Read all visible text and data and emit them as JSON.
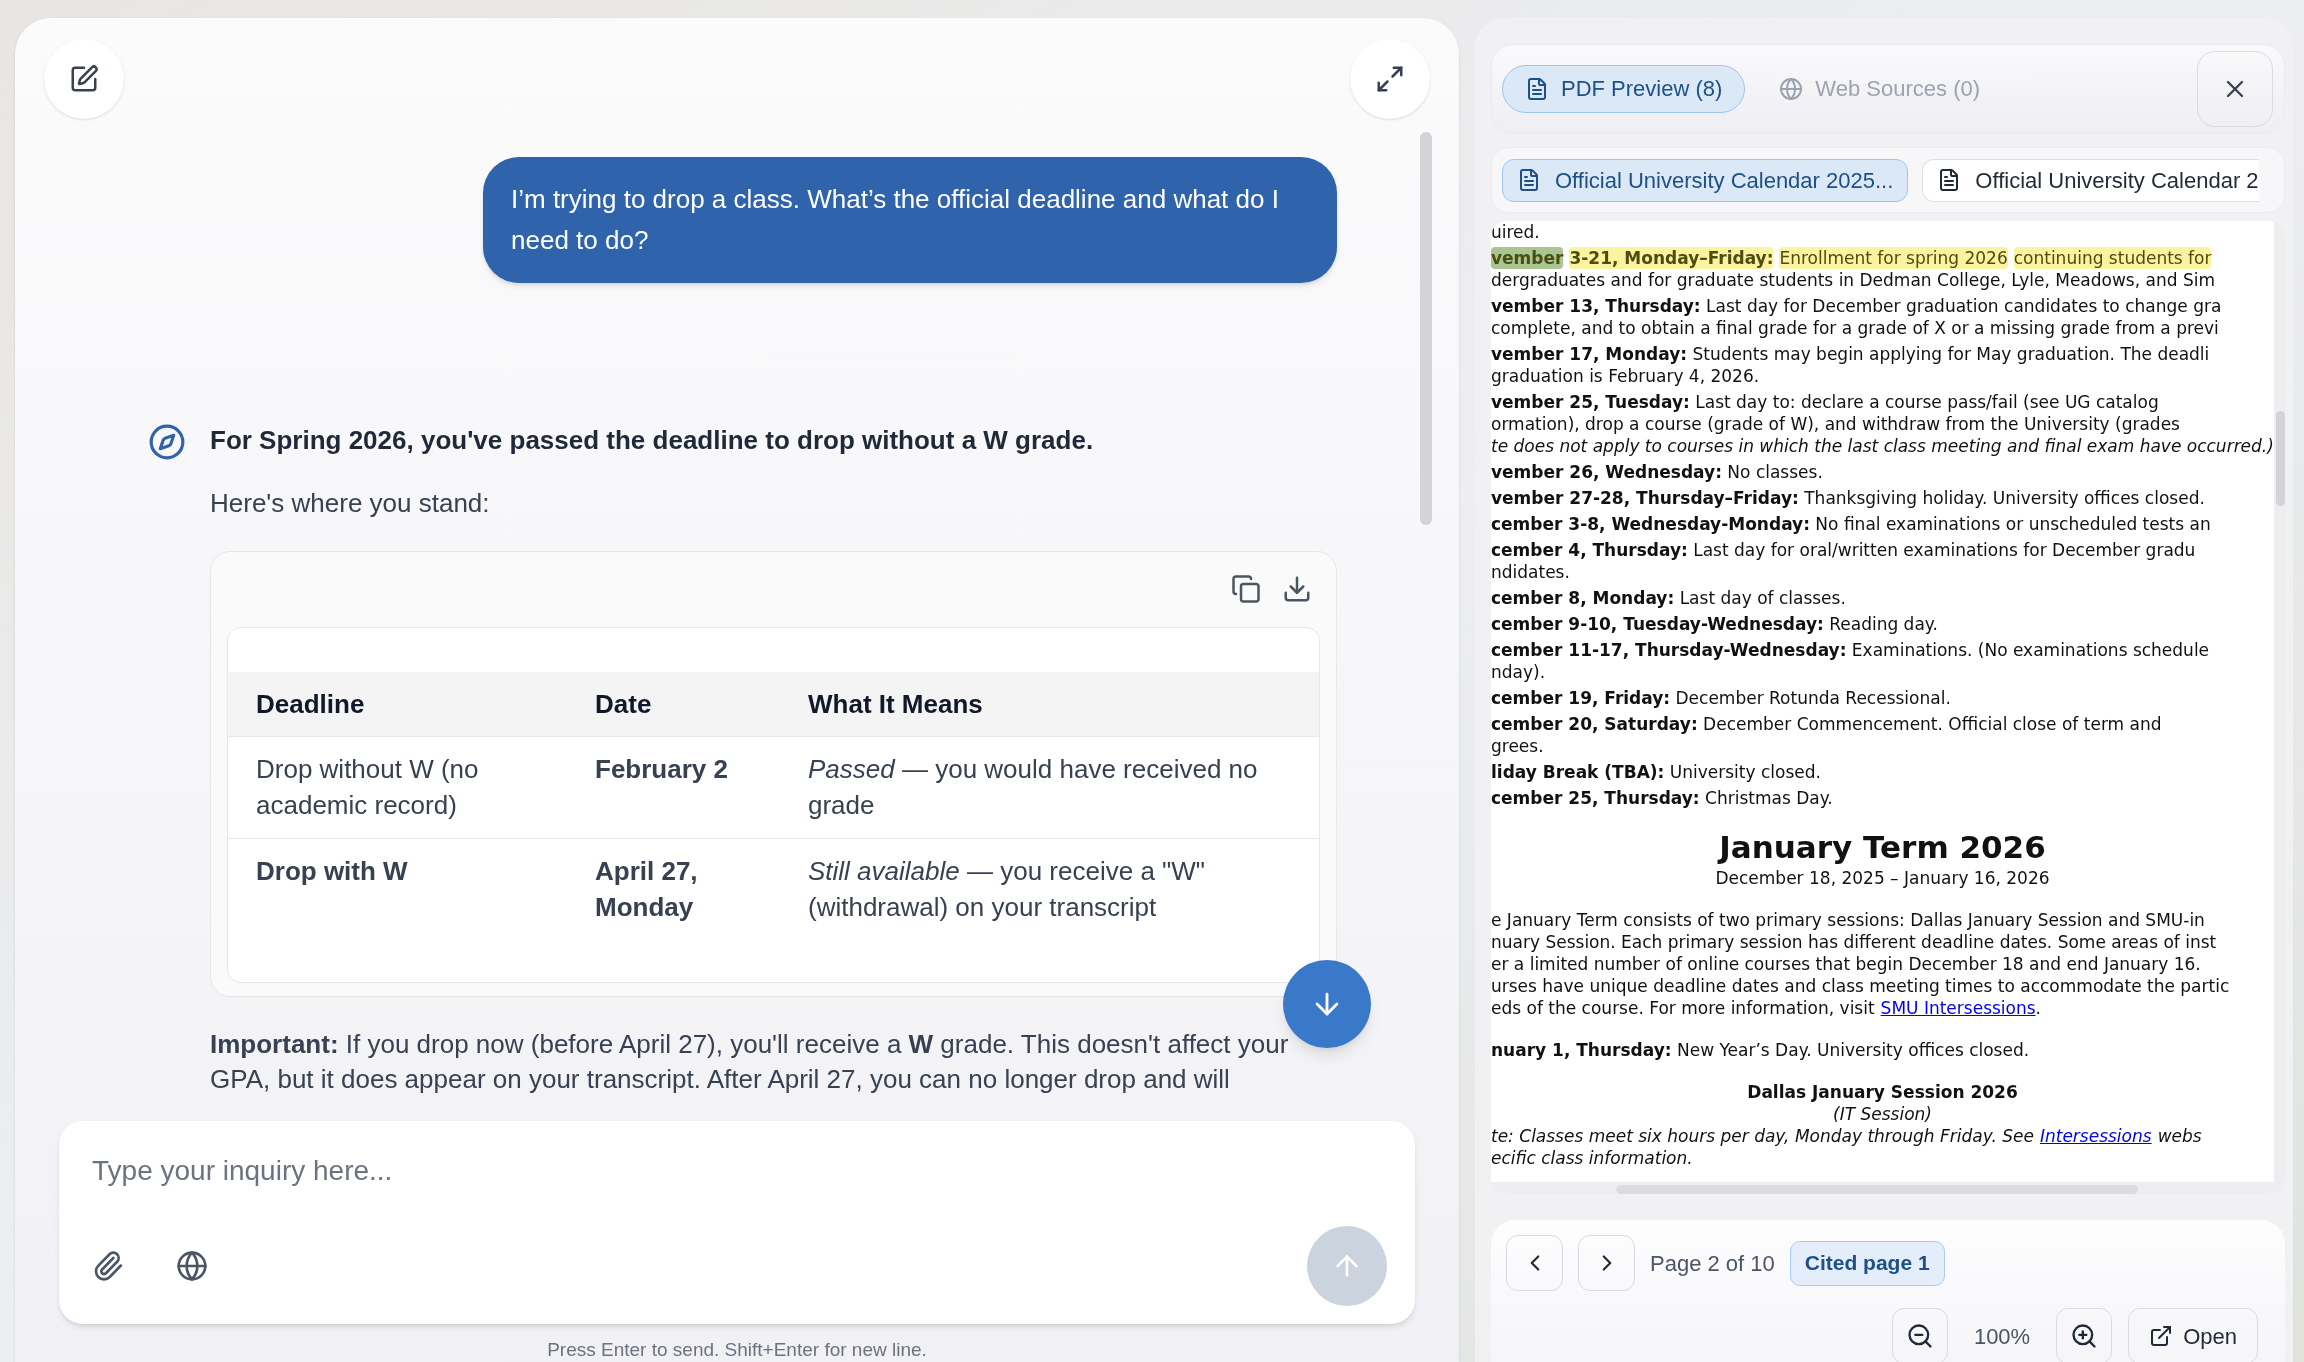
{
  "chat": {
    "messages": [
      {
        "kind": "user",
        "text": "I’m trying to drop a class. What’s the official deadline and what do I need to do?"
      },
      {
        "kind": "assistant",
        "lead": "For Spring 2026, you've passed the deadline to drop without a W grade.",
        "intro": "Here's where you stand:",
        "table": {
          "columns": [
            "Deadline",
            "Date",
            "What It Means"
          ],
          "rows": [
            [
              {
                "text": "Drop without W (no academic record)",
                "bold": false
              },
              {
                "text": "February 2",
                "bold": true
              },
              {
                "text": "*Passed* — you would have received no grade",
                "bold": false
              }
            ],
            [
              {
                "text": "Drop with W",
                "bold": true
              },
              {
                "text": "April 27, Monday",
                "bold": true
              },
              {
                "text": "*Still available* — you receive a \"W\" (withdrawal) on your transcript",
                "bold": false
              }
            ]
          ]
        },
        "note": "**Important:** If you drop now (before April 27), you'll receive a **W** grade. This doesn't affect your GPA, but it does appear on your transcript. After April 27, you can no longer drop and will"
      }
    ]
  },
  "composer": {
    "placeholder": "Type your inquiry here...",
    "hint": "Press Enter to send. Shift+Enter for new line."
  },
  "preview": {
    "tabs": [
      {
        "label": "PDF Preview (8)",
        "selected": true
      },
      {
        "label": "Web Sources (0)",
        "selected": false
      }
    ],
    "documents": [
      {
        "label": "Official University Calendar 2025...",
        "selected": true
      },
      {
        "label": "Official University Calendar 2",
        "selected": false
      }
    ],
    "pdf_lines": [
      {
        "kind": "wrap",
        "text": "uired."
      },
      {
        "kind": "highlighted",
        "segments": [
          {
            "text": "**vember**",
            "color": "#a8c592"
          },
          {
            "text": "**3-21, Monday–Friday:**",
            "color": "#fbf3a0"
          },
          {
            "text": "Enrollment for spring 2026",
            "color": "#fbf3a0"
          },
          {
            "text": "continuing students for",
            "color": "#fbf3a0"
          }
        ]
      },
      {
        "kind": "wrap",
        "text": "dergraduates and for graduate students in Dedman College, Lyle, Meadows, and Sim"
      },
      {
        "kind": "entry",
        "text": "**vember 13, Thursday:** Last day for December graduation candidates to change gra"
      },
      {
        "kind": "wrap",
        "text": "complete, and to obtain a final grade for a grade of X or a missing grade from a previ"
      },
      {
        "kind": "entry",
        "text": "**vember 17, Monday:** Students may begin applying for May graduation. The deadli"
      },
      {
        "kind": "wrap",
        "text": "graduation is February 4, 2026."
      },
      {
        "kind": "entry",
        "text": "**vember 25, Tuesday:** Last day to: declare a course pass/fail (see UG catalog"
      },
      {
        "kind": "wrap",
        "text": "ormation), drop a course (grade of W), and withdraw from the University (grades"
      },
      {
        "kind": "wrap",
        "text": "*te does not apply to courses in which the last class meeting and final exam have occurred.)*"
      },
      {
        "kind": "entry",
        "text": "**vember 26, Wednesday:** No classes."
      },
      {
        "kind": "entry",
        "text": "**vember 27-28, Thursday–Friday:** Thanksgiving holiday. University offices closed."
      },
      {
        "kind": "entry",
        "text": "**cember 3-8, Wednesday-Monday:** No final examinations or unscheduled tests an"
      },
      {
        "kind": "entry",
        "text": "**cember 4, Thursday:** Last day for oral/written examinations for December gradu"
      },
      {
        "kind": "wrap",
        "text": "ndidates."
      },
      {
        "kind": "entry",
        "text": "**cember 8, Monday:** Last day of classes."
      },
      {
        "kind": "entry",
        "text": "**cember 9-10, Tuesday-Wednesday:** Reading day."
      },
      {
        "kind": "entry",
        "text": "**cember 11-17, Thursday-Wednesday:** Examinations. (No examinations schedule"
      },
      {
        "kind": "wrap",
        "text": "nday)."
      },
      {
        "kind": "entry",
        "text": "**cember 19, Friday:** December Rotunda Recessional."
      },
      {
        "kind": "entry",
        "text": "**cember 20, Saturday:** December Commencement. Official close of term and"
      },
      {
        "kind": "wrap",
        "text": "grees."
      },
      {
        "kind": "entry",
        "text": "**liday Break (TBA):** University closed."
      },
      {
        "kind": "entry",
        "text": "**cember 25, Thursday:** Christmas Day."
      },
      {
        "kind": "title",
        "text": "January Term 2026"
      },
      {
        "kind": "subtitle",
        "text": "December 18, 2025 – January 16, 2026"
      },
      {
        "kind": "para",
        "text": "e January Term consists of two primary sessions: Dallas January Session and SMU-in"
      },
      {
        "kind": "wrap",
        "text": "nuary Session. Each primary session has different deadline dates. Some areas of inst"
      },
      {
        "kind": "wrap",
        "text": "er a limited number of online courses that begin December 18 and end January 16."
      },
      {
        "kind": "wrap",
        "text": "urses have unique deadline dates and class meeting times to accommodate the partic"
      },
      {
        "kind": "wrap",
        "text": "eds of the course. For more information, visit",
        "link": "SMU Intersessions",
        "after": "."
      },
      {
        "kind": "para",
        "text": "**nuary 1, Thursday:** New Year’s Day. University offices closed."
      },
      {
        "kind": "heading",
        "text": "Dallas January Session 2026"
      },
      {
        "kind": "subheading",
        "text": "(IT Session)"
      },
      {
        "kind": "note",
        "text": "te: Classes meet six hours per day, Monday through Friday. See",
        "link": "Intersessions",
        "after": "webs"
      },
      {
        "kind": "notewrap",
        "text": "ecific class information."
      }
    ],
    "pager": {
      "page": "Page 2 of 10",
      "cited": "Cited page 1",
      "zoom": "100%",
      "open": "Open"
    }
  }
}
